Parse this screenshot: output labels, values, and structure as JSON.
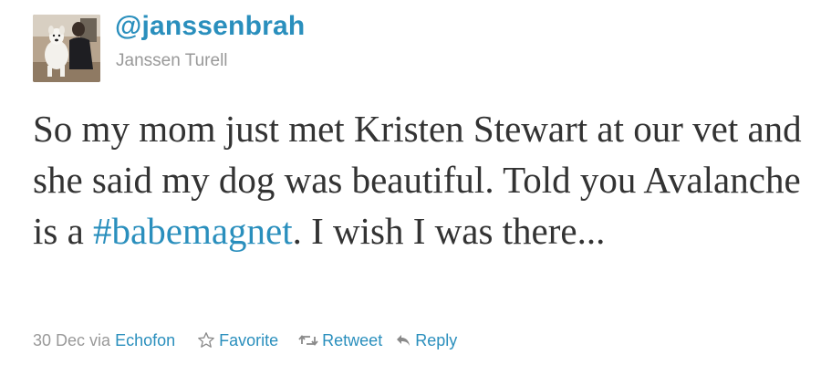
{
  "author": {
    "handle": "@janssenbrah",
    "name": "Janssen Turell"
  },
  "tweet": {
    "text_before": "So my mom just met Kristen Stewart at our vet and she said my dog was beautiful. Told you Avalanche is a ",
    "hashtag": "#babemagnet",
    "text_after": ". I wish I was there..."
  },
  "meta": {
    "timestamp": "30 Dec",
    "via_label": "via",
    "source": "Echofon"
  },
  "actions": {
    "favorite_label": "Favorite",
    "retweet_label": "Retweet",
    "reply_label": "Reply"
  },
  "icons": {
    "favorite": "star-outline-icon",
    "retweet": "retweet-icon",
    "reply": "reply-arrow-icon"
  },
  "colors": {
    "link": "#2a8fbd",
    "text": "#333333",
    "muted": "#999999",
    "background": "#ffffff"
  }
}
